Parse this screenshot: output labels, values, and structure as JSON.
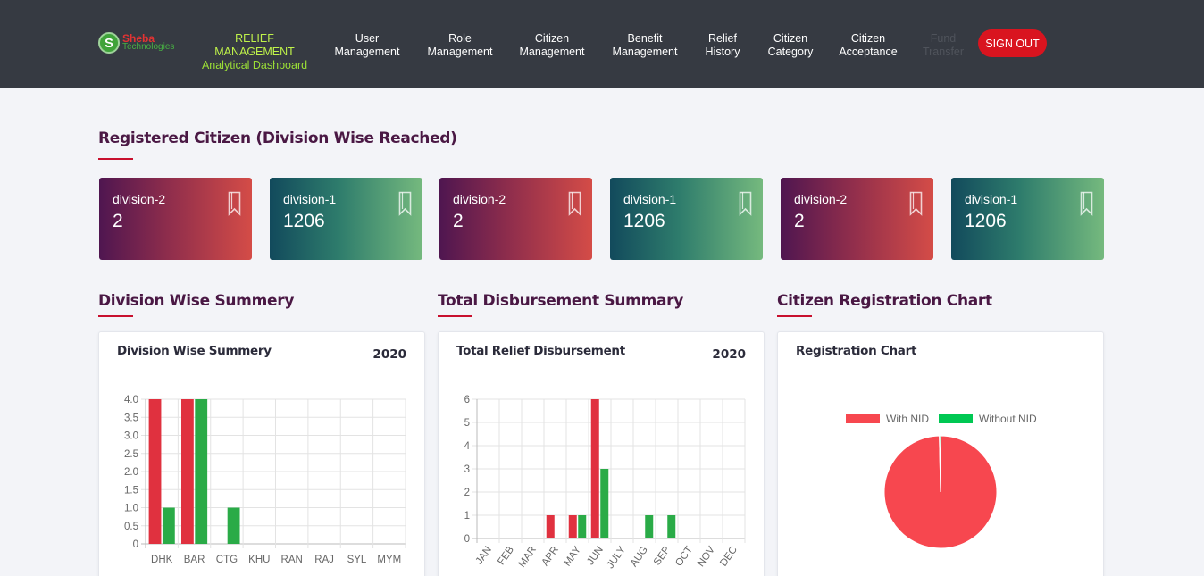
{
  "nav": {
    "logo_line1": "Sheba",
    "logo_line2": "Technologies",
    "logo_letter": "S",
    "brand_line1": "RELIEF MANAGEMENT",
    "brand_line2": "Analytical Dashboard",
    "items": [
      {
        "l1": "User",
        "l2": "Management"
      },
      {
        "l1": "Role",
        "l2": "Management"
      },
      {
        "l1": "Citizen",
        "l2": "Management"
      },
      {
        "l1": "Benefit",
        "l2": "Management"
      },
      {
        "l1": "Relief",
        "l2": "History"
      },
      {
        "l1": "Citizen",
        "l2": "Category"
      },
      {
        "l1": "Citizen",
        "l2": "Acceptance"
      },
      {
        "l1": "Fund",
        "l2": "Transfer"
      }
    ],
    "signout": "SIGN OUT"
  },
  "registered": {
    "title": "Registered Citizen (Division Wise Reached)",
    "cards": [
      {
        "label": "division-2",
        "value": "2"
      },
      {
        "label": "division-1",
        "value": "1206"
      },
      {
        "label": "division-2",
        "value": "2"
      },
      {
        "label": "division-1",
        "value": "1206"
      },
      {
        "label": "division-2",
        "value": "2"
      },
      {
        "label": "division-1",
        "value": "1206"
      }
    ]
  },
  "sections": {
    "division": "Division Wise Summery",
    "disbursement": "Total Disbursement Summary",
    "registration": "Citizen Registration Chart"
  },
  "panels": {
    "division": {
      "title": "Division Wise Summery",
      "year": "2020"
    },
    "disbursement": {
      "title": "Total Relief Disbursement",
      "year": "2020"
    },
    "registration": {
      "title": "Registration Chart"
    }
  },
  "colors": {
    "series_red": "#e0313f",
    "series_green": "#2aab47",
    "pie_red": "#f7474f",
    "pie_green": "#00c853"
  },
  "chart_data": [
    {
      "type": "bar",
      "title": "Division Wise Summery",
      "categories": [
        "DHK",
        "BAR",
        "CTG",
        "KHU",
        "RAN",
        "RAJ",
        "SYL",
        "MYM"
      ],
      "series": [
        {
          "values": [
            4,
            4,
            0,
            0,
            0,
            0,
            0,
            0
          ]
        },
        {
          "values": [
            1,
            4,
            1,
            0,
            0,
            0,
            0,
            0
          ]
        }
      ],
      "yticks": [
        "0",
        "0.5",
        "1.0",
        "1.5",
        "2.0",
        "2.5",
        "3.0",
        "3.5",
        "4.0"
      ],
      "ylim": [
        0,
        4
      ],
      "grid": true
    },
    {
      "type": "bar",
      "title": "Total Relief Disbursement",
      "categories": [
        "JAN",
        "FEB",
        "MAR",
        "APR",
        "MAY",
        "JUN",
        "JULY",
        "AUG",
        "SEP",
        "OCT",
        "NOV",
        "DEC"
      ],
      "series": [
        {
          "values": [
            0,
            0,
            0,
            1,
            1,
            6,
            0,
            0,
            0,
            0,
            0,
            0
          ]
        },
        {
          "values": [
            0,
            0,
            0,
            0,
            1,
            3,
            0,
            1,
            1,
            0,
            0,
            0
          ]
        }
      ],
      "yticks": [
        "0",
        "1",
        "2",
        "3",
        "4",
        "5",
        "6"
      ],
      "ylim": [
        0,
        6
      ],
      "grid": true
    },
    {
      "type": "pie",
      "title": "Registration Chart",
      "labels": [
        "With NID",
        "Without NID"
      ],
      "values": [
        1206,
        4
      ],
      "legend": "top"
    }
  ]
}
